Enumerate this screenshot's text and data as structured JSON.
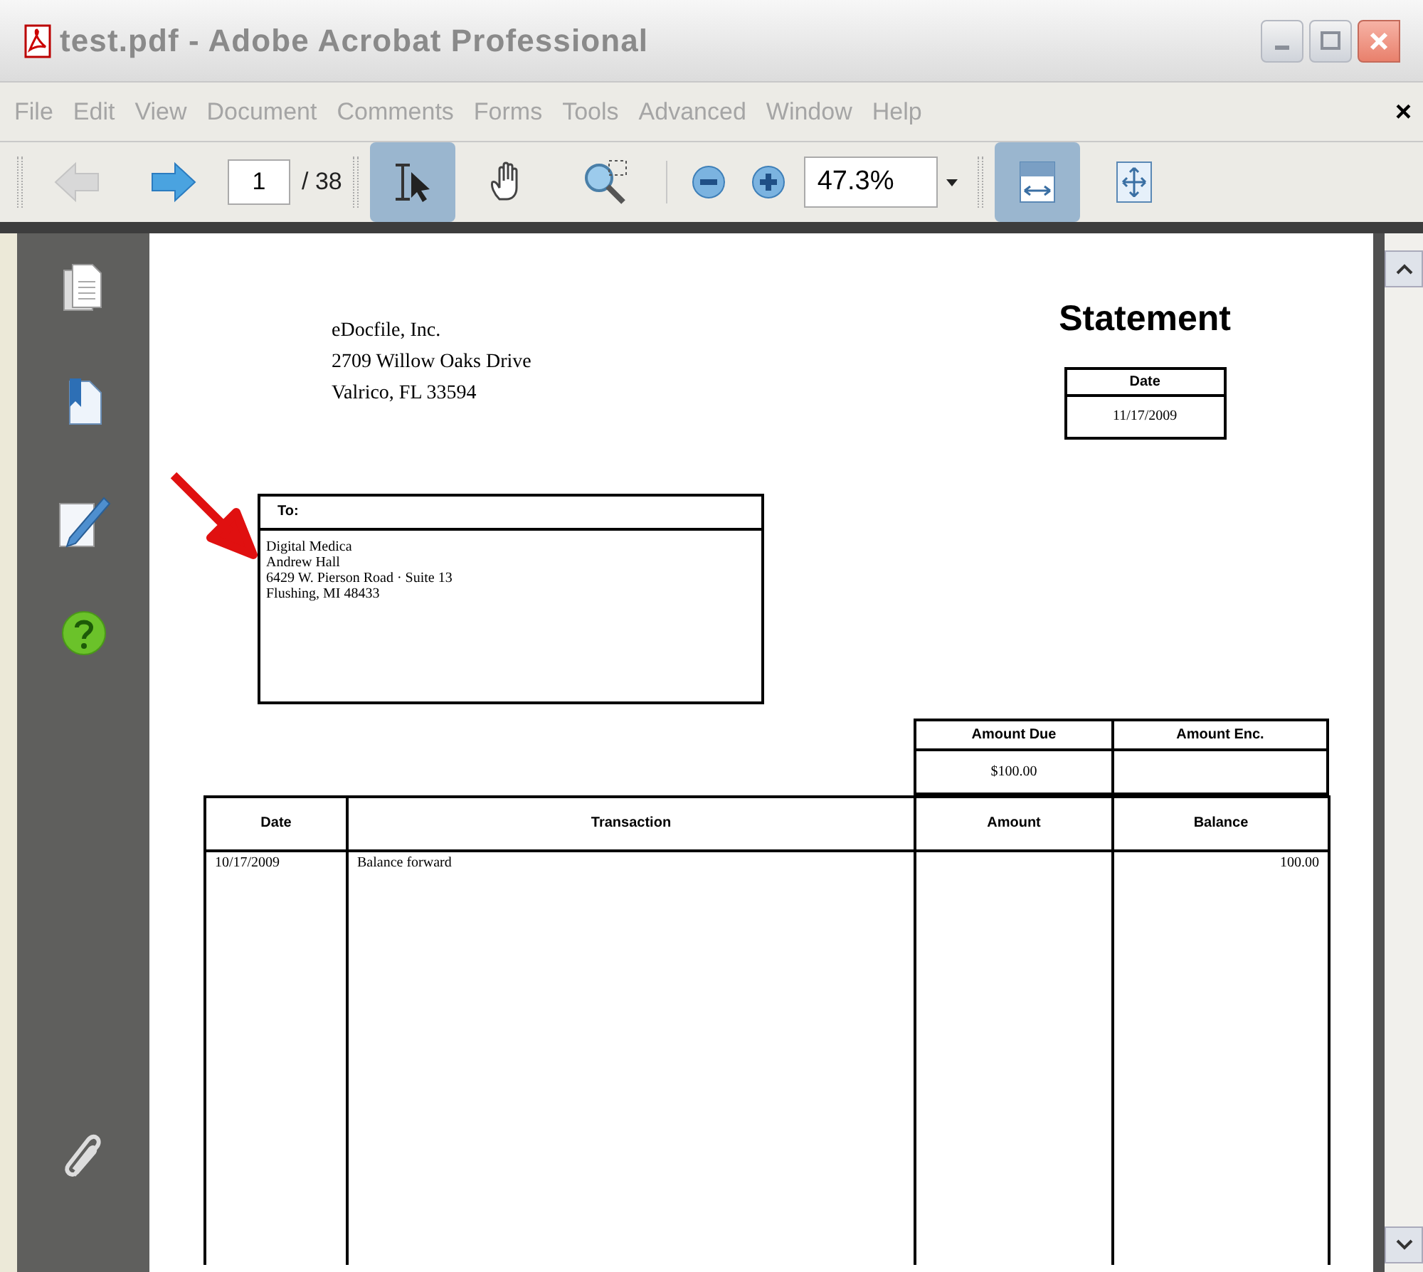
{
  "window": {
    "title": "test.pdf - Adobe Acrobat Professional"
  },
  "menu": [
    "File",
    "Edit",
    "View",
    "Document",
    "Comments",
    "Forms",
    "Tools",
    "Advanced",
    "Window",
    "Help"
  ],
  "menu_close": "×",
  "toolbar": {
    "page_number": "1",
    "page_total": "/ 38",
    "zoom": "47.3%",
    "tools": [
      {
        "kind": "select",
        "selected": true
      },
      {
        "kind": "hand",
        "selected": false
      },
      {
        "kind": "marquee",
        "selected": false
      }
    ],
    "views": [
      {
        "kind": "fit-width",
        "selected": true
      },
      {
        "kind": "fit-page",
        "selected": false
      }
    ]
  },
  "sidebar": {
    "items": [
      {
        "kind": "pages"
      },
      {
        "kind": "bookmarks"
      },
      {
        "kind": "signatures"
      },
      {
        "kind": "help"
      }
    ],
    "bottom": [
      {
        "kind": "attachments"
      }
    ]
  },
  "document": {
    "sender": [
      "eDocfile, Inc.",
      "2709 Willow Oaks Drive",
      "Valrico, FL 33594"
    ],
    "title": "Statement",
    "date_box": {
      "label": "Date",
      "value": "11/17/2009"
    },
    "to_box": {
      "label": "To:",
      "lines": [
        "Digital Medica",
        "Andrew Hall",
        "6429 W. Pierson Road · Suite 13",
        "Flushing, MI 48433"
      ]
    },
    "amount_box": {
      "columns": [
        "Amount Due",
        "Amount Enc."
      ],
      "values": [
        "$100.00"
      ]
    },
    "table": {
      "columns": [
        "Date",
        "Transaction",
        "Amount",
        "Balance"
      ],
      "rows": [
        {
          "date": "10/17/2009",
          "transaction": "Balance forward",
          "balance": "100.00"
        }
      ]
    }
  }
}
